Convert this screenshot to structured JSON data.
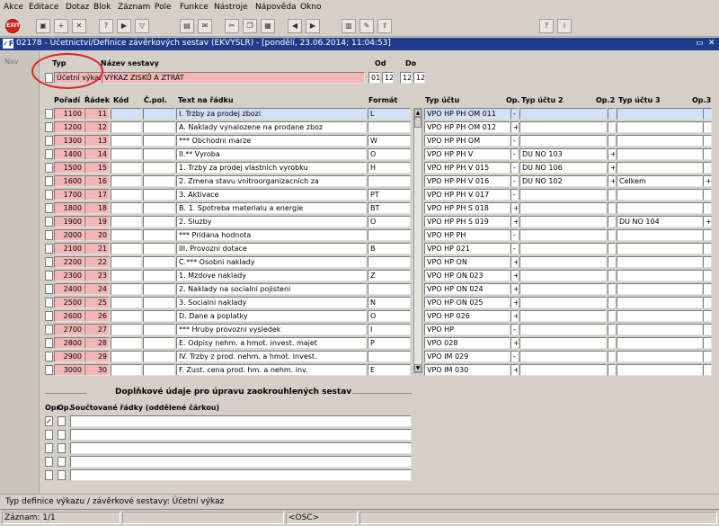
{
  "menu": [
    "Akce",
    "Editace",
    "Dotaz",
    "Blok",
    "Záznam",
    "Pole",
    "Funkce",
    "Nástroje",
    "Nápověda",
    "Okno"
  ],
  "toolbar_icons": [
    "exit-icon",
    "save-icon",
    "new-record-icon",
    "delete-record-icon",
    "query-icon",
    "execute-query-icon",
    "filter-icon",
    "print-icon",
    "mail-icon",
    "cut-icon",
    "copy-icon",
    "paste-icon",
    "previous-icon",
    "next-icon",
    "calendar-icon",
    "edit-icon",
    "export-icon",
    "help-icon",
    "about-icon"
  ],
  "window": {
    "logo": "✓F",
    "title": "02178 - Účetnictví/Definice závěrkových sestav (EKVYSLR) - [pondělí, 23.06.2014; 11:04:53]",
    "restore": "▭",
    "close": "✕"
  },
  "nav_label": "Nav",
  "header": {
    "typ_label": "Typ",
    "nazev_label": "Název sestavy",
    "od_label": "Od",
    "do_label": "Do",
    "typ_value": "Účetní výkaz",
    "nazev_value": "VÝKAZ ZISKŮ A ZTRÁT",
    "od_1": "01",
    "od_2": "12",
    "do_1": "12",
    "do_2": "12"
  },
  "table": {
    "columns": {
      "poradi": "Pořadí",
      "radek": "Řádek",
      "kod": "Kód",
      "cpol": "Č.pol.",
      "text": "Text na řádku",
      "format": "Formát",
      "typ1": "Typ účtu",
      "op1": "Op.",
      "typ2": "Typ účtu 2",
      "op2": "Op.2",
      "typ3": "Typ účtu 3",
      "op3": "Op.3"
    },
    "rows": [
      {
        "poradi": "1100",
        "radek": "11",
        "kod": "",
        "cpol": "",
        "text": "I.    Trzby za prodej zbozi",
        "format": "L",
        "typ1": "VPO HP PH OM 011",
        "op1": "-",
        "typ2": "",
        "op2": "",
        "typ3": "",
        "op3": ""
      },
      {
        "poradi": "1200",
        "radek": "12",
        "kod": "",
        "cpol": "",
        "text": "A.    Naklady vynalozene na prodane zboz",
        "format": "",
        "typ1": "VPO HP PH OM 012",
        "op1": "+",
        "typ2": "",
        "op2": "",
        "typ3": "",
        "op3": ""
      },
      {
        "poradi": "1300",
        "radek": "13",
        "kod": "",
        "cpol": "",
        "text": "   *** Obchodni marze",
        "format": "W",
        "typ1": "VPO HP PH OM",
        "op1": "-",
        "typ2": "",
        "op2": "",
        "typ3": "",
        "op3": ""
      },
      {
        "poradi": "1400",
        "radek": "14",
        "kod": "",
        "cpol": "",
        "text": "II.** Vyroba",
        "format": "O",
        "typ1": "VPO HP PH V",
        "op1": "-",
        "typ2": "DU NO 103",
        "op2": "+",
        "typ3": "",
        "op3": ""
      },
      {
        "poradi": "1500",
        "radek": "15",
        "kod": "",
        "cpol": "",
        "text": "   1. Trzby za prodej vlastnich vyrobku",
        "format": "H",
        "typ1": "VPO HP PH V 015",
        "op1": "-",
        "typ2": "DU NO 106",
        "op2": "+",
        "typ3": "",
        "op3": ""
      },
      {
        "poradi": "1600",
        "radek": "16",
        "kod": "",
        "cpol": "",
        "text": "   2. Zmena stavu vnitroorganizacnich za",
        "format": "",
        "typ1": "VPO HP PH V 016",
        "op1": "-",
        "typ2": "DU NO 102",
        "op2": "+",
        "typ3": "Celkem",
        "op3": "+"
      },
      {
        "poradi": "1700",
        "radek": "17",
        "kod": "",
        "cpol": "",
        "text": "   3. Aktivace",
        "format": "PT",
        "typ1": "VPO HP PH V 017",
        "op1": "-",
        "typ2": "",
        "op2": "",
        "typ3": "",
        "op3": ""
      },
      {
        "poradi": "1800",
        "radek": "18",
        "kod": "",
        "cpol": "",
        "text": "B. 1. Spotreba materialu a energie",
        "format": "BT",
        "typ1": "VPO HP PH S 018",
        "op1": "+",
        "typ2": "",
        "op2": "",
        "typ3": "",
        "op3": ""
      },
      {
        "poradi": "1900",
        "radek": "19",
        "kod": "",
        "cpol": "",
        "text": "   2. Sluzby",
        "format": "O",
        "typ1": "VPO HP PH S 019",
        "op1": "+",
        "typ2": "",
        "op2": "",
        "typ3": "DU NO 104",
        "op3": "+"
      },
      {
        "poradi": "2000",
        "radek": "20",
        "kod": "",
        "cpol": "",
        "text": "   *** Pridana hodnota",
        "format": "",
        "typ1": "VPO HP PH",
        "op1": "-",
        "typ2": "",
        "op2": "",
        "typ3": "",
        "op3": ""
      },
      {
        "poradi": "2100",
        "radek": "21",
        "kod": "",
        "cpol": "",
        "text": "III.  Provozni dotace",
        "format": "B",
        "typ1": "VPO HP 021",
        "op1": "-",
        "typ2": "",
        "op2": "",
        "typ3": "",
        "op3": ""
      },
      {
        "poradi": "2200",
        "radek": "22",
        "kod": "",
        "cpol": "",
        "text": "C.*** Osobni naklady",
        "format": "",
        "typ1": "VPO HP ON",
        "op1": "+",
        "typ2": "",
        "op2": "",
        "typ3": "",
        "op3": ""
      },
      {
        "poradi": "2300",
        "radek": "23",
        "kod": "",
        "cpol": "",
        "text": "   1. Mzdove naklady",
        "format": "Z",
        "typ1": "VPO HP ON 023",
        "op1": "+",
        "typ2": "",
        "op2": "",
        "typ3": "",
        "op3": ""
      },
      {
        "poradi": "2400",
        "radek": "24",
        "kod": "",
        "cpol": "",
        "text": "   2. Naklady na socialni pojisteni",
        "format": "",
        "typ1": "VPO HP ON 024",
        "op1": "+",
        "typ2": "",
        "op2": "",
        "typ3": "",
        "op3": ""
      },
      {
        "poradi": "2500",
        "radek": "25",
        "kod": "",
        "cpol": "",
        "text": "   3. Socialni naklady",
        "format": "N",
        "typ1": "VPO HP ON 025",
        "op1": "+",
        "typ2": "",
        "op2": "",
        "typ3": "",
        "op3": ""
      },
      {
        "poradi": "2600",
        "radek": "26",
        "kod": "",
        "cpol": "",
        "text": "D.    Dane a poplatky",
        "format": "O",
        "typ1": "VPO HP 026",
        "op1": "+",
        "typ2": "",
        "op2": "",
        "typ3": "",
        "op3": ""
      },
      {
        "poradi": "2700",
        "radek": "27",
        "kod": "",
        "cpol": "",
        "text": "   *** Hruby provozni vysledek",
        "format": "I",
        "typ1": "VPO HP",
        "op1": "-",
        "typ2": "",
        "op2": "",
        "typ3": "",
        "op3": ""
      },
      {
        "poradi": "2800",
        "radek": "28",
        "kod": "",
        "cpol": "",
        "text": "E.    Odpisy nehm. a hmot. invest. majet",
        "format": "P",
        "typ1": "VPO 028",
        "op1": "+",
        "typ2": "",
        "op2": "",
        "typ3": "",
        "op3": ""
      },
      {
        "poradi": "2900",
        "radek": "29",
        "kod": "",
        "cpol": "",
        "text": "IV.   Trzby z prod. nehm. a hmot. invest.",
        "format": "",
        "typ1": "VPO IM 029",
        "op1": "-",
        "typ2": "",
        "op2": "",
        "typ3": "",
        "op3": ""
      },
      {
        "poradi": "3000",
        "radek": "30",
        "kod": "",
        "cpol": "",
        "text": "F.    Zust. cena prod. hm. a nehm. inv.",
        "format": "E",
        "typ1": "VPO IM 030",
        "op1": "+",
        "typ2": "",
        "op2": "",
        "typ3": "",
        "op3": ""
      }
    ]
  },
  "bottom": {
    "title": "Doplňkové údaje pro úpravu zaokrouhlených sestav",
    "col_opr": "Opr.",
    "col_op": "Op.",
    "col_sum": "Součtované řádky (oddělené čárkou)",
    "rows": [
      {
        "checked": "✓",
        "op": "",
        "sum": ""
      },
      {
        "checked": "",
        "op": "",
        "sum": ""
      },
      {
        "checked": "",
        "op": "",
        "sum": ""
      },
      {
        "checked": "",
        "op": "",
        "sum": ""
      },
      {
        "checked": "",
        "op": "",
        "sum": ""
      }
    ]
  },
  "status": {
    "message": "Typ definice výkazu / závěrkové sestavy: Účetní výkaz",
    "record": "Záznam: 1/1",
    "osc": "<OSC>"
  },
  "colors": {
    "titlebar": "#1f3c8c",
    "pink": "#f4b5b5",
    "selected": "#cfe0f8",
    "highlight_circle": "#e02020"
  }
}
